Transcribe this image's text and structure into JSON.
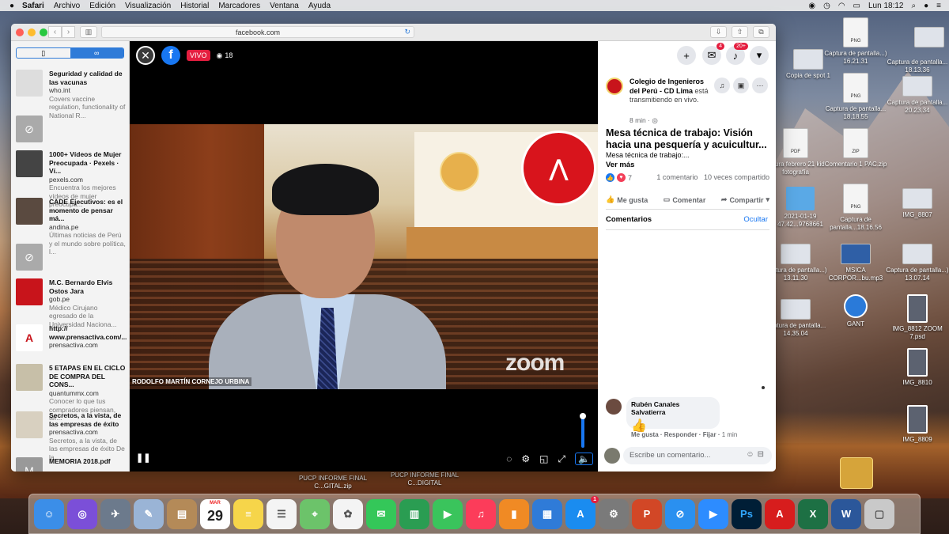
{
  "menubar": {
    "apple": "",
    "items": [
      "Safari",
      "Archivo",
      "Edición",
      "Visualización",
      "Historial",
      "Marcadores",
      "Ventana",
      "Ayuda"
    ],
    "clock": "Lun 18:12"
  },
  "browser": {
    "url": "facebook.com"
  },
  "reading_list": {
    "items": [
      {
        "title": "Seguridad y calidad de las vacunas",
        "site": "who.int",
        "desc": "Covers vaccine regulation, functionality of National R..."
      },
      {
        "title": "",
        "site": "",
        "desc": ""
      },
      {
        "title": "1000+ Vídeos de Mujer Preocupada · Pexels · Ví...",
        "site": "pexels.com",
        "desc": "Encuentra los mejores vídeos de mujer preocupa..."
      },
      {
        "title": "CADE Ejecutivos: es el momento de pensar má...",
        "site": "andina.pe",
        "desc": "Últimas noticias de Perú y el mundo sobre política, l..."
      },
      {
        "title": "",
        "site": "",
        "desc": ""
      },
      {
        "title": "M.C. Bernardo Elvis Ostos Jara",
        "site": "gob.pe",
        "desc": "Médico Cirujano egresado de la Universidad Naciona..."
      },
      {
        "title": "http:// www.prensactiva.com/...",
        "site": "prensactiva.com",
        "desc": ""
      },
      {
        "title": "5 ETAPAS EN EL CICLO DE COMPRA DEL CONS...",
        "site": "quantummx.com",
        "desc": "Conocer lo que tus compradores piensan, ter..."
      },
      {
        "title": "Secretos, a la vista, de las empresas de éxito",
        "site": "prensactiva.com",
        "desc": "Secretos, a la vista, de las empresas de éxito De la..."
      },
      {
        "title": "MEMORIA 2018.pdf",
        "site": "",
        "desc": ""
      }
    ]
  },
  "video": {
    "live_label": "VIVO",
    "viewers": "18",
    "speaker_name": "RODOLFO MARTÍN CORNEJO URBINA",
    "watermark": "zoom"
  },
  "fb": {
    "messenger_badge": "4",
    "notif_badge": "20+",
    "org_name": "Colegio de Ingenieros del Perú - CD Lima",
    "org_status": "está transmitiendo en vivo.",
    "post_time": "8 min ·",
    "title_line1": "Mesa técnica de trabajo: Visión",
    "title_line2": "hacia una pesquería y acuicultur...",
    "subtitle": "Mesa técnica de trabajo:...",
    "ver_mas": "Ver más",
    "reaction_count": "7",
    "comment_count": "1 comentario",
    "share_count": "10 veces compartido",
    "like_label": "Me gusta",
    "comment_label": "Comentar",
    "share_label": "Compartir",
    "comments_header": "Comentarios",
    "hide_label": "Ocultar",
    "comment": {
      "author": "Rubén Canales Salvatierra",
      "text": "👍",
      "like": "Me gusta",
      "reply": "Responder",
      "pin": "Fijar",
      "time": "1 min"
    },
    "write_placeholder": "Escribe un comentario..."
  },
  "desktop": {
    "icons": [
      {
        "label": "Copia de spot 1",
        "kind": "wide"
      },
      {
        "label": "Captura de pantalla...) 16.21.31",
        "kind": "png"
      },
      {
        "label": "Captura de pantalla... 18.13.36",
        "kind": "wide"
      },
      {
        "label": "Captura de pantalla... 18.18.55",
        "kind": "png"
      },
      {
        "label": "Captura de pantalla... 20.23.34",
        "kind": "wide"
      },
      {
        "label": "actura febrero 21 kid fotografía",
        "kind": "pdf"
      },
      {
        "label": "Comentario 1 PAC.zip",
        "kind": "zip"
      },
      {
        "label": "2021-01-19 47.42...9768661",
        "kind": "folder"
      },
      {
        "label": "Captura de pantalla...18.16.56",
        "kind": "png"
      },
      {
        "label": "IMG_8807",
        "kind": "wide"
      },
      {
        "label": "Captura de pantalla...) 13.11.30",
        "kind": "wide"
      },
      {
        "label": "MSICA CORPOR...bu.mp3",
        "kind": "blue"
      },
      {
        "label": "Captura de pantalla...) 13.07.14",
        "kind": "wide"
      },
      {
        "label": "Captura de pantalla... 14.35.04",
        "kind": "wide"
      },
      {
        "label": "GANT",
        "kind": "app"
      },
      {
        "label": "IMG_8812 ZOOM 7.psd",
        "kind": "photo"
      },
      {
        "label": "IMG_8810",
        "kind": "photo"
      },
      {
        "label": "IMG_8809",
        "kind": "photo"
      }
    ],
    "bottom_files": [
      "PUCP INFORME FINAL C...GITAL.zip",
      "PUCP INFORME FINAL C...DIGITAL"
    ]
  },
  "dock": {
    "calendar_month": "MAR",
    "calendar_day": "29",
    "appstore_badge": "1",
    "apps": [
      "finder",
      "siri",
      "launchpad",
      "preview",
      "contacts",
      "calendar",
      "notes",
      "reminders",
      "maps",
      "photos",
      "messages",
      "numbers",
      "facetime",
      "music",
      "books",
      "keynote",
      "appstore",
      "system-preferences",
      "powerpoint",
      "safari",
      "zoom",
      "photoshop",
      "acrobat",
      "excel",
      "word",
      "trash"
    ],
    "app_colors": {
      "finder": "#3b8ee8",
      "siri": "#7b4fd8",
      "launchpad": "#6c7a8c",
      "preview": "#9ab4d6",
      "contacts": "#b48a58",
      "notes": "#f6d54a",
      "reminders": "#f4f4f4",
      "maps": "#6cc36a",
      "photos": "#f4f4f4",
      "messages": "#34c759",
      "numbers": "#2a9d52",
      "facetime": "#3ac45c",
      "music": "#fc3c5a",
      "books": "#f08a24",
      "keynote": "#2f7bd8",
      "appstore": "#1a8cf0",
      "system-preferences": "#7a7a7a",
      "powerpoint": "#d24726",
      "safari": "#2a90f0",
      "zoom": "#2d8cff",
      "photoshop": "#001e36",
      "acrobat": "#d71d1d",
      "excel": "#1d7044",
      "word": "#2b579a",
      "trash": "#c9c9c9"
    }
  }
}
